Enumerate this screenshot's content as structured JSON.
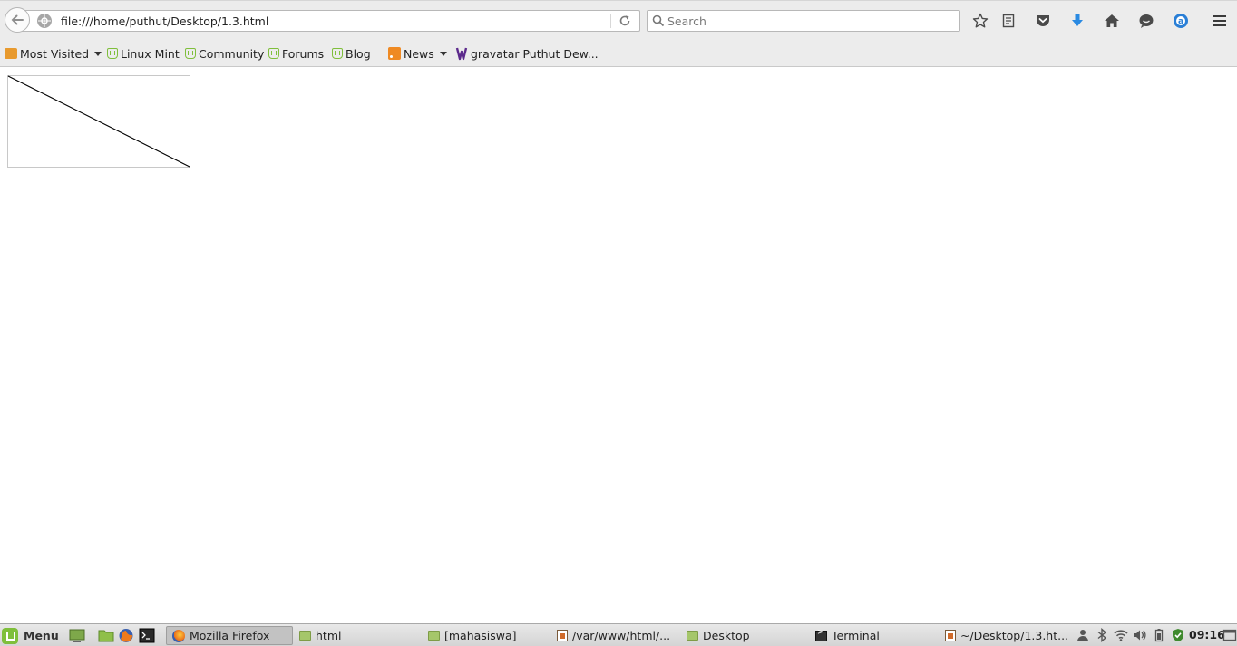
{
  "browser": {
    "url": "file:///home/puthut/Desktop/1.3.html",
    "search_placeholder": "Search"
  },
  "bookmarks": {
    "most_visited": "Most Visited",
    "linux_mint": "Linux Mint",
    "community": "Community",
    "forums": "Forums",
    "blog": "Blog",
    "news": "News",
    "gravatar": "gravatar Puthut Dew..."
  },
  "page": {
    "canvas": {
      "line_from": "top-left",
      "line_to": "bottom-right",
      "border_color": "#c8c8c8",
      "line_color": "#000000"
    }
  },
  "taskbar": {
    "menu_label": "Menu",
    "tasks": [
      "Mozilla Firefox",
      "html",
      "[mahasiswa]",
      "/var/www/html/...",
      "Desktop",
      "Terminal",
      "~/Desktop/1.3.ht..."
    ],
    "clock": "09:16"
  },
  "colors": {
    "toolbar_bg": "#ececec",
    "download_accent": "#2a8ae2",
    "mint_green": "#7fbf3b"
  }
}
